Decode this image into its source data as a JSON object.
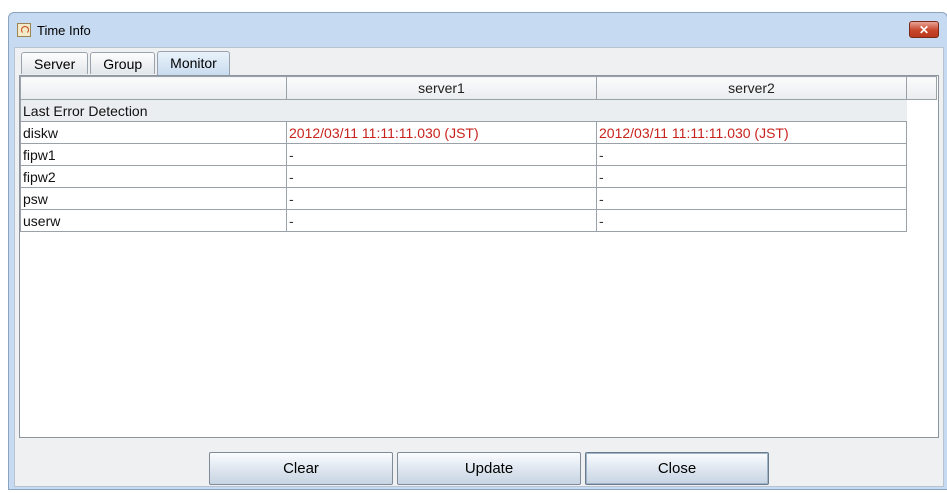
{
  "window": {
    "title": "Time Info",
    "close_label": "✕",
    "app_icon": "java-cup-icon"
  },
  "tabs": [
    {
      "label": "Server"
    },
    {
      "label": "Group"
    },
    {
      "label": "Monitor",
      "active": true
    }
  ],
  "table": {
    "columns": [
      "",
      "server1",
      "server2"
    ],
    "group_label": "Last Error Detection",
    "rows": [
      {
        "name": "diskw",
        "server1": "2012/03/11 11:11:11.030 (JST)",
        "server2": "2012/03/11 11:11:11.030 (JST)",
        "error": true
      },
      {
        "name": "fipw1",
        "server1": "-",
        "server2": "-"
      },
      {
        "name": "fipw2",
        "server1": "-",
        "server2": "-"
      },
      {
        "name": "psw",
        "server1": "-",
        "server2": "-"
      },
      {
        "name": "userw",
        "server1": "-",
        "server2": "-"
      }
    ]
  },
  "buttons": {
    "clear": "Clear",
    "update": "Update",
    "close": "Close"
  },
  "colors": {
    "error_text": "#c8221c",
    "window_frame": "#c6dbf1"
  }
}
